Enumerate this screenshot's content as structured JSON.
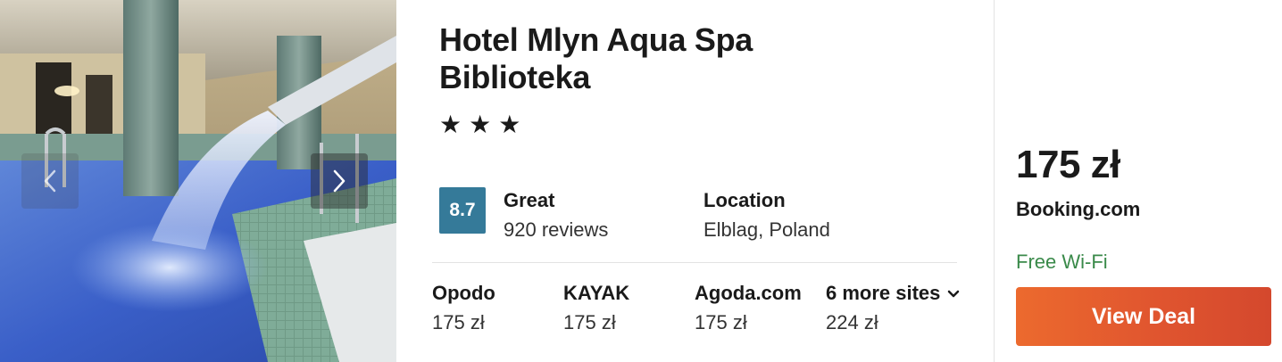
{
  "hotel": {
    "name": "Hotel Mlyn Aqua Spa Biblioteka",
    "star_rating": 3,
    "stars": [
      "★",
      "★",
      "★"
    ],
    "photo": {
      "prev_icon": "chevron-left-icon",
      "next_icon": "chevron-right-icon"
    }
  },
  "rating": {
    "score": "8.7",
    "label": "Great",
    "reviews": "920 reviews",
    "badge_color": "#357a99"
  },
  "location": {
    "label": "Location",
    "value": "Elblag, Poland"
  },
  "sites": [
    {
      "name": "Opodo",
      "price": "175 zł"
    },
    {
      "name": "KAYAK",
      "price": "175 zł"
    },
    {
      "name": "Agoda.com",
      "price": "175 zł"
    },
    {
      "name": "6 more sites",
      "price": "224 zł",
      "icon": "chevron-down-icon"
    }
  ],
  "deal": {
    "price": "175 zł",
    "provider": "Booking.com",
    "amenity": "Free Wi-Fi",
    "amenity_color": "#3a8a4a",
    "button_label": "View Deal",
    "button_color": "#e2582f"
  }
}
